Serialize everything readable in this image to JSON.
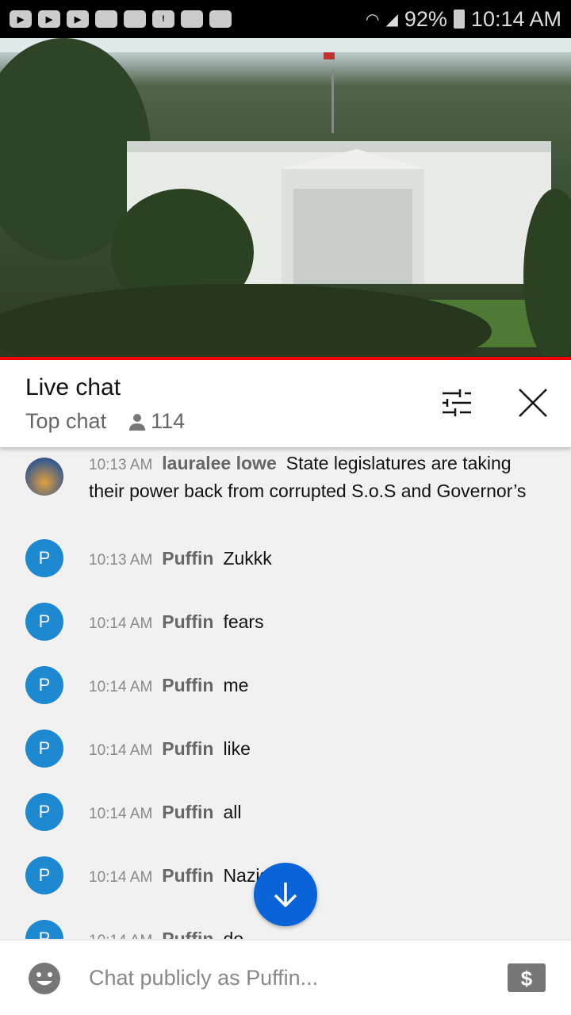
{
  "status_bar": {
    "battery": "92%",
    "time": "10:14 AM",
    "notification_icons": [
      "youtube-icon",
      "youtube-icon",
      "youtube-icon",
      "folder-icon",
      "m-app-icon",
      "warning-icon",
      "image-icon",
      "calendar-icon"
    ]
  },
  "video": {
    "description_icon": "video-player"
  },
  "colors": {
    "progress": "#ee0000",
    "avatar": "#1e88d0",
    "fab": "#0b63d8"
  },
  "header": {
    "title": "Live chat",
    "mode": "Top chat",
    "viewer_count": "114"
  },
  "messages": [
    {
      "avatar": "",
      "time": "10:13 AM",
      "author": "lauralee lowe",
      "text": "State legislatures are taking their power back from corrupted S.o.S and Governor’s"
    },
    {
      "avatar": "P",
      "time": "10:13 AM",
      "author": "Puffin",
      "text": "Zukkk"
    },
    {
      "avatar": "P",
      "time": "10:14 AM",
      "author": "Puffin",
      "text": "fears"
    },
    {
      "avatar": "P",
      "time": "10:14 AM",
      "author": "Puffin",
      "text": "me"
    },
    {
      "avatar": "P",
      "time": "10:14 AM",
      "author": "Puffin",
      "text": "like"
    },
    {
      "avatar": "P",
      "time": "10:14 AM",
      "author": "Puffin",
      "text": "all"
    },
    {
      "avatar": "P",
      "time": "10:14 AM",
      "author": "Puffin",
      "text": "Nazis"
    },
    {
      "avatar": "P",
      "time": "10:14 AM",
      "author": "Puffin",
      "text": "do"
    }
  ],
  "input": {
    "placeholder": "Chat publicly as Puffin..."
  }
}
